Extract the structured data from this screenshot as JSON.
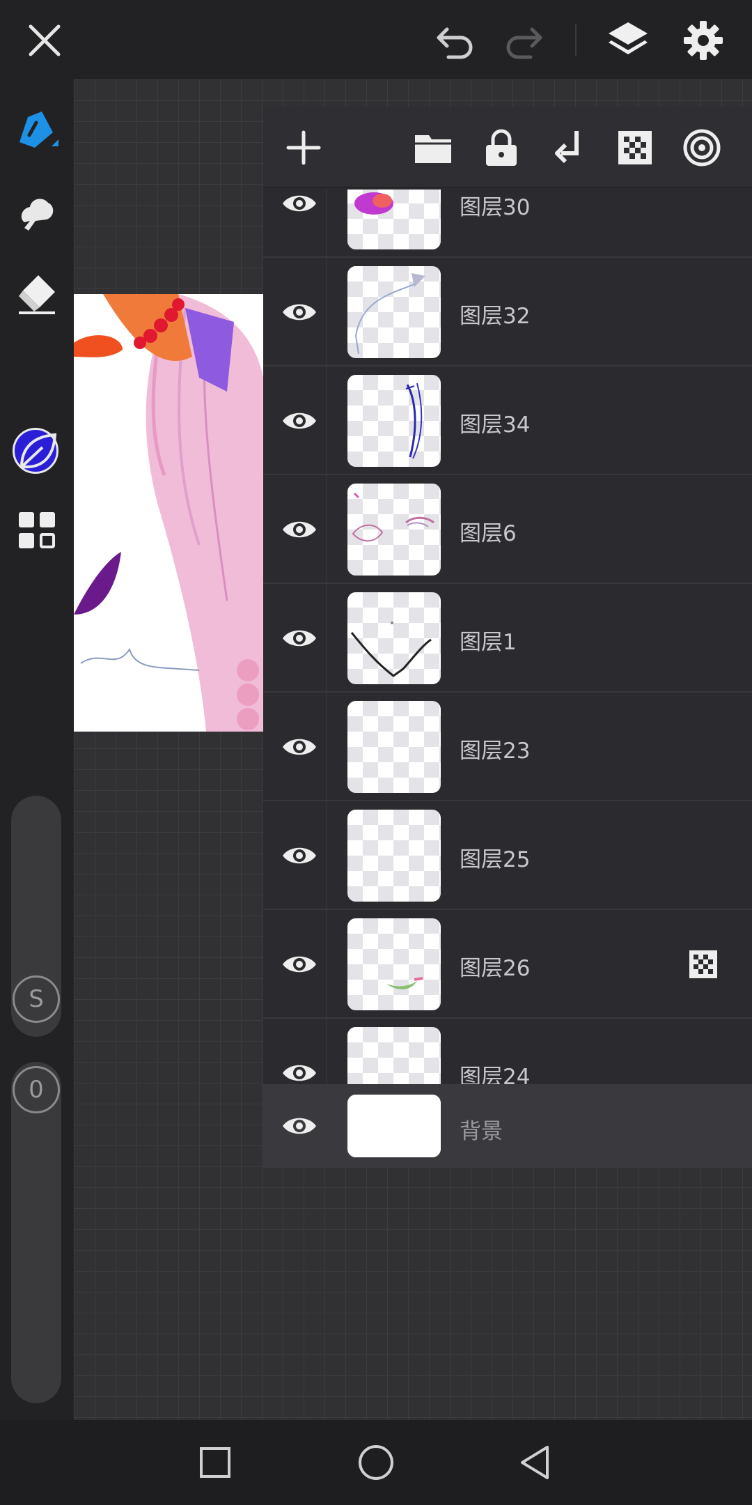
{
  "app": {
    "top_icons": [
      "close-icon",
      "undo-icon",
      "redo-icon",
      "layers-icon",
      "settings-icon"
    ],
    "accent_color": "#1e90e6"
  },
  "tools": [
    "pencil-icon",
    "smudge-icon",
    "eraser-icon",
    "color-swatch",
    "leaf-icon",
    "grid-icon"
  ],
  "current_color": "#2a1fd6",
  "sliders": {
    "size_label": "S",
    "opacity_label": "0"
  },
  "layers_panel": {
    "header_icons": [
      "add-icon",
      "folder-icon",
      "lock-icon",
      "merge-down-icon",
      "transparency-icon",
      "clipping-icon"
    ],
    "layers": [
      {
        "name": "图层30",
        "visible": true
      },
      {
        "name": "图层32",
        "visible": true
      },
      {
        "name": "图层34",
        "visible": true
      },
      {
        "name": "图层6",
        "visible": true
      },
      {
        "name": "图层1",
        "visible": true
      },
      {
        "name": "图层23",
        "visible": true
      },
      {
        "name": "图层25",
        "visible": true
      },
      {
        "name": "图层26",
        "visible": true,
        "alpha_locked": true
      },
      {
        "name": "图层24",
        "visible": true
      }
    ],
    "background": {
      "name": "背景",
      "visible": true
    }
  },
  "nav": [
    "square-icon",
    "circle-icon",
    "back-triangle-icon"
  ]
}
